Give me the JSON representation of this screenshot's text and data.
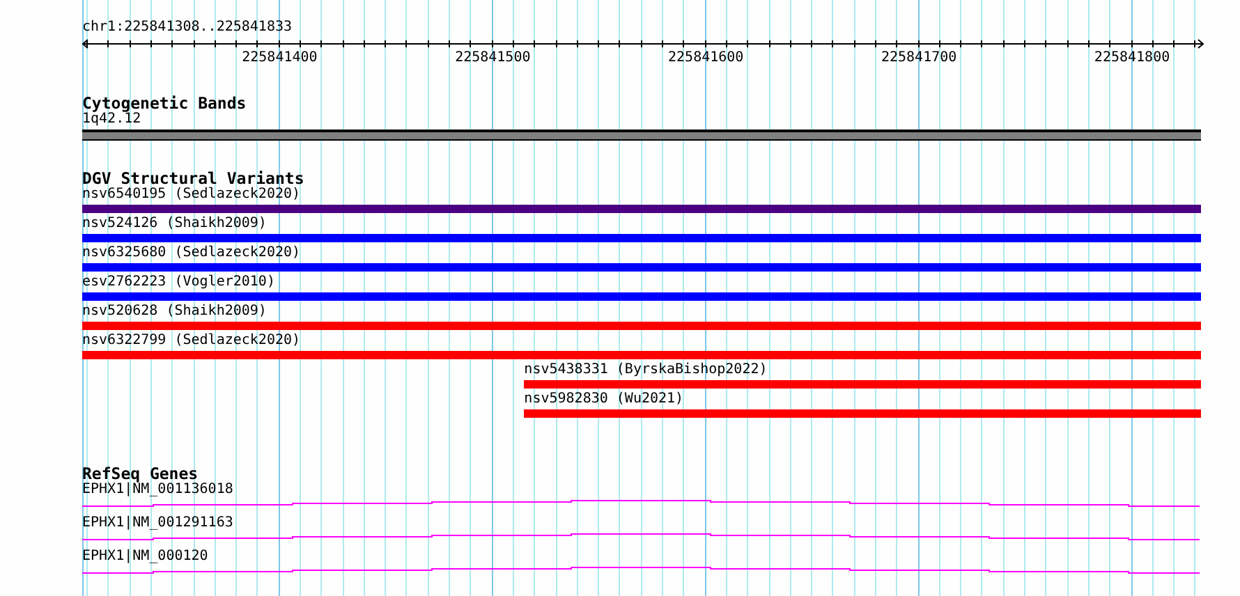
{
  "ruler": {
    "range": "chr1:225841308..225841833",
    "ticks": [
      "225841400",
      "225841500",
      "225841600",
      "225841700",
      "225841800"
    ]
  },
  "tracks": [
    {
      "title": "Cytogenetic Bands",
      "features": [
        {
          "kind": "band",
          "label": "1q42.12"
        }
      ]
    },
    {
      "title": "DGV Structural Variants",
      "features": [
        {
          "kind": "variant",
          "label": "nsv6540195 (Sedlazeck2020)",
          "color": "#4b0082",
          "extends_left": true
        },
        {
          "kind": "variant",
          "label": "nsv524126 (Shaikh2009)",
          "color": "#0000ff",
          "extends_left": true
        },
        {
          "kind": "variant",
          "label": "nsv6325680 (Sedlazeck2020)",
          "color": "#0000ff",
          "extends_left": true
        },
        {
          "kind": "variant",
          "label": "esv2762223 (Vogler2010)",
          "color": "#0000ff",
          "extends_left": true
        },
        {
          "kind": "variant",
          "label": "nsv520628 (Shaikh2009)",
          "color": "#ff0000",
          "extends_left": true
        },
        {
          "kind": "variant",
          "label": "nsv6322799 (Sedlazeck2020)",
          "color": "#ff0000",
          "extends_left": true
        },
        {
          "kind": "variant",
          "label": "nsv5438331 (ByrskaBishop2022)",
          "color": "#ff0000",
          "extends_left": false
        },
        {
          "kind": "variant",
          "label": "nsv5982830 (Wu2021)",
          "color": "#ff0000",
          "extends_left": false
        }
      ]
    },
    {
      "title": "RefSeq Genes",
      "features": [
        {
          "kind": "gene",
          "label": "EPHX1|NM_001136018"
        },
        {
          "kind": "gene",
          "label": "EPHX1|NM_001291163"
        },
        {
          "kind": "gene",
          "label": "EPHX1|NM_000120"
        }
      ]
    }
  ]
}
